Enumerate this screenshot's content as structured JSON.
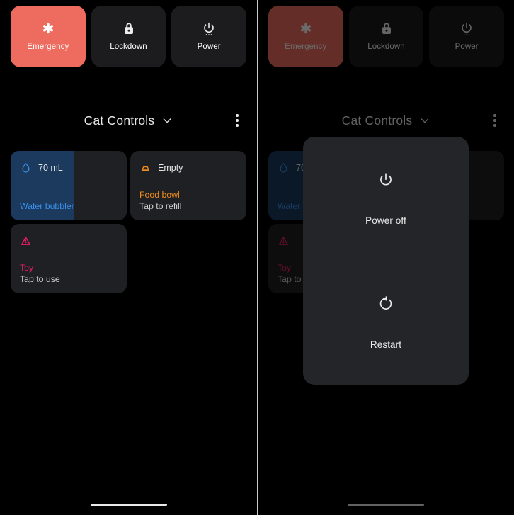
{
  "colors": {
    "emergency_bg": "#ee6c5f",
    "panel_bg": "#000000",
    "card_bg": "#1f2023",
    "water_fill": "#1b3a5e",
    "water_accent": "#3b8fe8",
    "food_accent": "#ee8b1f",
    "toy_accent": "#ea1f63",
    "dialog_bg": "#232529",
    "text_primary": "#e8e8e8",
    "text_secondary": "#cfcfcf"
  },
  "quick_actions": [
    {
      "label": "Emergency",
      "icon": "asterisk-icon",
      "state": "active"
    },
    {
      "label": "Lockdown",
      "icon": "lock-icon",
      "state": "normal"
    },
    {
      "label": "Power",
      "icon": "power-icon",
      "state": "normal"
    }
  ],
  "header": {
    "title": "Cat Controls",
    "dropdown_icon": "chevron-down-icon",
    "overflow_icon": "kebab-menu-icon"
  },
  "controls": [
    {
      "status": "70 mL",
      "name": "Water bubbler",
      "subtitle": "",
      "icon": "water-drop-icon",
      "accent": "#3b8fe8",
      "fill_percent": 54
    },
    {
      "status": "Empty",
      "name": "Food bowl",
      "subtitle": "Tap to refill",
      "icon": "food-bowl-icon",
      "accent": "#ee8b1f",
      "fill_percent": 0
    },
    {
      "status": "",
      "name": "Toy",
      "subtitle": "Tap to use",
      "icon": "toy-laser-icon",
      "accent": "#ea1f63",
      "fill_percent": 0
    }
  ],
  "power_dialog": {
    "options": [
      {
        "label": "Power off",
        "icon": "power-icon"
      },
      {
        "label": "Restart",
        "icon": "restart-icon"
      }
    ]
  },
  "nav": {
    "home_indicator": "home-indicator"
  }
}
